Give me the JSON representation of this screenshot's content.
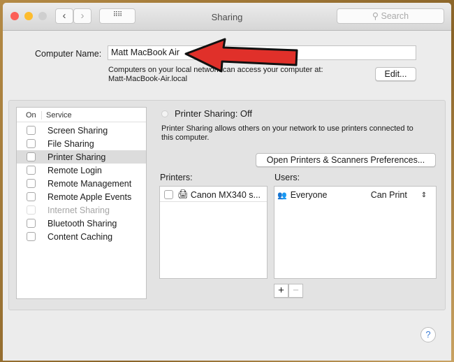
{
  "window": {
    "title": "Sharing",
    "search_placeholder": "Search"
  },
  "computer_name": {
    "label": "Computer Name:",
    "value": "Matt MacBook Air",
    "info_line1": "Computers on your local network can access your computer at:",
    "info_line2": "Matt-MacBook-Air.local",
    "edit_label": "Edit..."
  },
  "services": {
    "col_on": "On",
    "col_service": "Service",
    "items": [
      {
        "label": "Screen Sharing",
        "checked": false
      },
      {
        "label": "File Sharing",
        "checked": false
      },
      {
        "label": "Printer Sharing",
        "checked": false,
        "selected": true
      },
      {
        "label": "Remote Login",
        "checked": false
      },
      {
        "label": "Remote Management",
        "checked": false
      },
      {
        "label": "Remote Apple Events",
        "checked": false
      },
      {
        "label": "Internet Sharing",
        "checked": false,
        "disabled": true
      },
      {
        "label": "Bluetooth Sharing",
        "checked": false
      },
      {
        "label": "Content Caching",
        "checked": false
      }
    ]
  },
  "detail": {
    "status": "Printer Sharing: Off",
    "desc_line1": "Printer Sharing allows others on your network to use printers connected to",
    "desc_line2": "this computer.",
    "open_prefs_label": "Open Printers & Scanners Preferences...",
    "printers_label": "Printers:",
    "users_label": "Users:",
    "printers": [
      "Canon MX340 s..."
    ],
    "users": [
      {
        "name": "Everyone",
        "permission": "Can Print"
      }
    ],
    "add": "+",
    "remove": "−"
  },
  "help": "?",
  "colors": {
    "arrow": "#e0302a",
    "close": "#fc5f57",
    "minimize": "#fdbc2e"
  }
}
